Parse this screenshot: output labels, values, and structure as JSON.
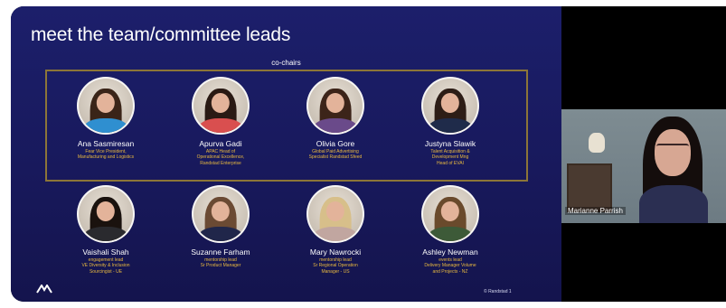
{
  "slide": {
    "title": "meet the team/committee leads",
    "section_label": "co-chairs",
    "co_chairs": [
      {
        "name": "Ana Sasmiresan",
        "role": "Fear Vice President,\nManufacturing and Logistics",
        "hair": "#3a2418",
        "top": "#2f8fd0"
      },
      {
        "name": "Apurva Gadi",
        "role": "APAC Head of\nOperational Excellence,\nRandstad Enterprise",
        "hair": "#2a1a14",
        "top": "#d94f4f"
      },
      {
        "name": "Olivia Gore",
        "role": "Global Paid Advertising\nSpecialist Randstad Sfeed",
        "hair": "#3c2419",
        "top": "#6a4a8a"
      },
      {
        "name": "Justyna Slawik",
        "role": "Talent Acquisition &\nDevelopment Mng\nHead of EVAI",
        "hair": "#2d1d16",
        "top": "#1f2b4a"
      }
    ],
    "leads": [
      {
        "name": "Vaishali Shah",
        "role": "engagement lead\nVE Diversity & Inclusion\nSourcingist - UE",
        "hair": "#1a120e",
        "top": "#2a2a2e"
      },
      {
        "name": "Suzanne Farham",
        "role": "mentorship lead\nSr Product Manager",
        "hair": "#6b4a33",
        "top": "#20264a"
      },
      {
        "name": "Mary Nawrocki",
        "role": "mentorship lead\nSr Regional Operation\nManager - US",
        "hair": "#d7bf8a",
        "top": "#c1a6a0"
      },
      {
        "name": "Ashley Newman",
        "role": "events lead\nDelivery Manager Volume\nand Projects - NZ",
        "hair": "#6a4a2c",
        "top": "#3d5a38"
      }
    ],
    "footer": "© Randstad   1"
  },
  "webcam": {
    "participant_name": "Marianne Parrish"
  },
  "colors": {
    "slide_bg": "#1a1c64",
    "gold_border": "#8c7538",
    "role_text": "#e8b93f"
  },
  "icons": {
    "brand": "randstad-logo-icon"
  }
}
